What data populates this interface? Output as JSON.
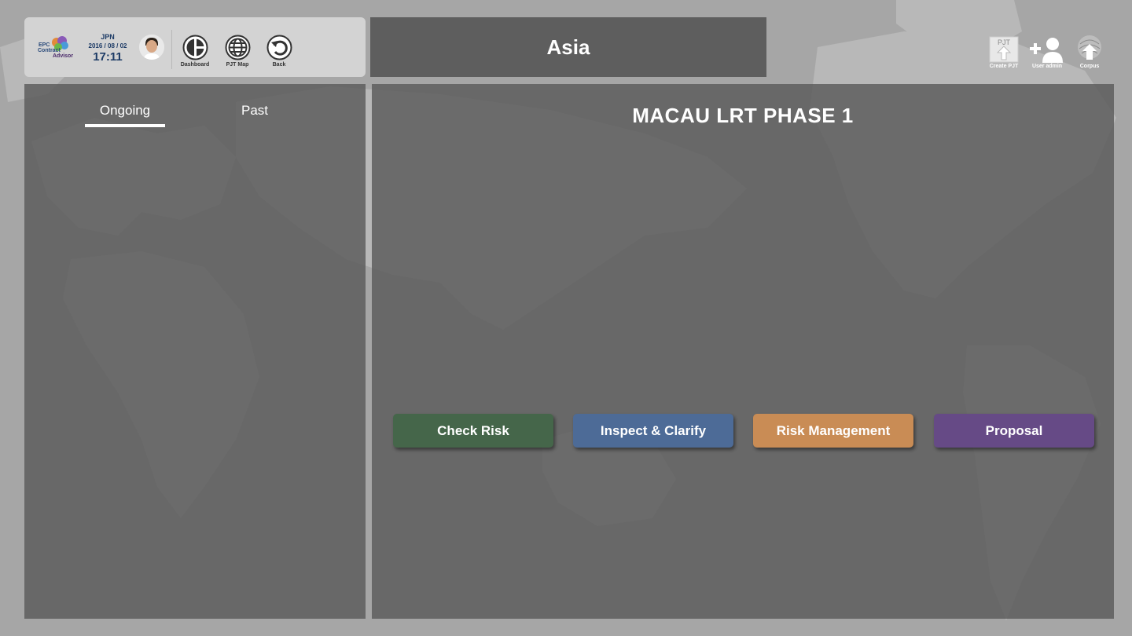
{
  "header": {
    "logo": {
      "line1": "EPC",
      "line2": "Contract",
      "line3": "Advisor"
    },
    "country": "JPN",
    "date": "2016 / 08 / 02",
    "time": "17:11",
    "nav": [
      {
        "label": "Dashboard",
        "icon": "dashboard-icon"
      },
      {
        "label": "PJT Map",
        "icon": "globe-icon"
      },
      {
        "label": "Back",
        "icon": "back-arrow-icon"
      }
    ]
  },
  "region_title": "Asia",
  "tools": [
    {
      "label": "Create PJT",
      "icon": "create-project-icon",
      "badge": "PJT"
    },
    {
      "label": "User admin",
      "icon": "add-user-icon"
    },
    {
      "label": "Corpus",
      "icon": "corpus-upload-icon"
    }
  ],
  "tabs": {
    "ongoing": "Ongoing",
    "past": "Past",
    "active": "Ongoing"
  },
  "project": {
    "title": "MACAU LRT PHASE 1",
    "actions": [
      {
        "label": "Check Risk",
        "color": "#45664a"
      },
      {
        "label": "Inspect & Clarify",
        "color": "#4d6b97"
      },
      {
        "label": "Risk Management",
        "color": "#c98c55"
      },
      {
        "label": "Proposal",
        "color": "#664a86"
      }
    ]
  },
  "colors": {
    "background": "#a9a9a9",
    "panel": "#5e5e5e",
    "header_card": "#d3d3d3",
    "header_text": "#1d3b66"
  }
}
